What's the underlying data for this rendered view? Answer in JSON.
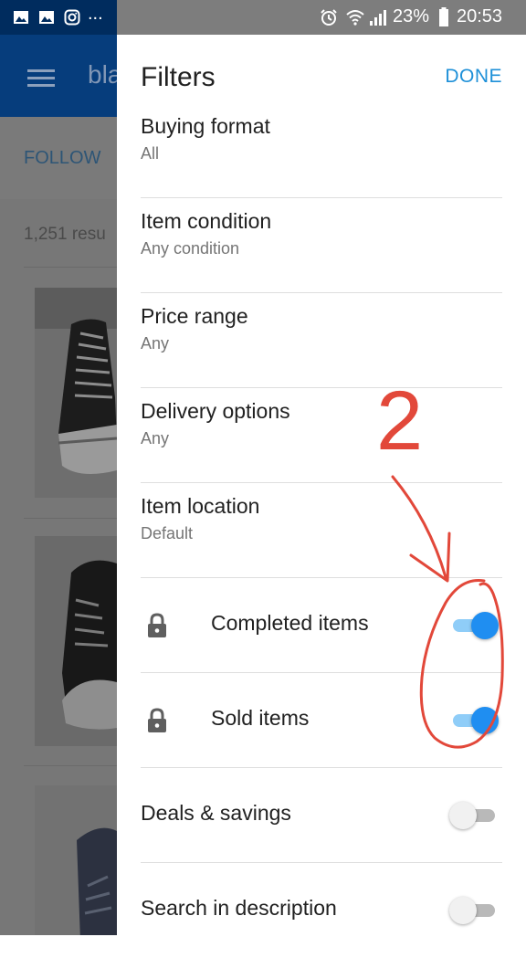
{
  "status_bar": {
    "left_icons": [
      "image-icon",
      "image-icon",
      "instagram-icon"
    ],
    "left_more": "...",
    "right_icons": [
      "alarm-icon",
      "wifi-icon",
      "signal-icon"
    ],
    "battery": "23%",
    "time": "20:53"
  },
  "background_app": {
    "title_partial": "bla",
    "follow_label": "FOLLOW",
    "results_text": "1,251 resu"
  },
  "drawer": {
    "title": "Filters",
    "done_label": "DONE",
    "rows": [
      {
        "label": "Buying format",
        "value": "All"
      },
      {
        "label": "Item condition",
        "value": "Any condition"
      },
      {
        "label": "Price range",
        "value": "Any"
      },
      {
        "label": "Delivery options",
        "value": "Any"
      },
      {
        "label": "Item location",
        "value": "Default"
      }
    ],
    "toggles": [
      {
        "label": "Completed items",
        "locked": true,
        "on": true
      },
      {
        "label": "Sold items",
        "locked": true,
        "on": true
      },
      {
        "label": "Deals & savings",
        "locked": false,
        "on": false
      },
      {
        "label": "Search in description",
        "locked": false,
        "on": false
      }
    ]
  },
  "annotation": {
    "number": "2",
    "color": "#e2483a"
  },
  "colors": {
    "accent": "#1e90d8",
    "switch_on": "#1f8ef1",
    "status_bar_left": "#002c5e"
  }
}
